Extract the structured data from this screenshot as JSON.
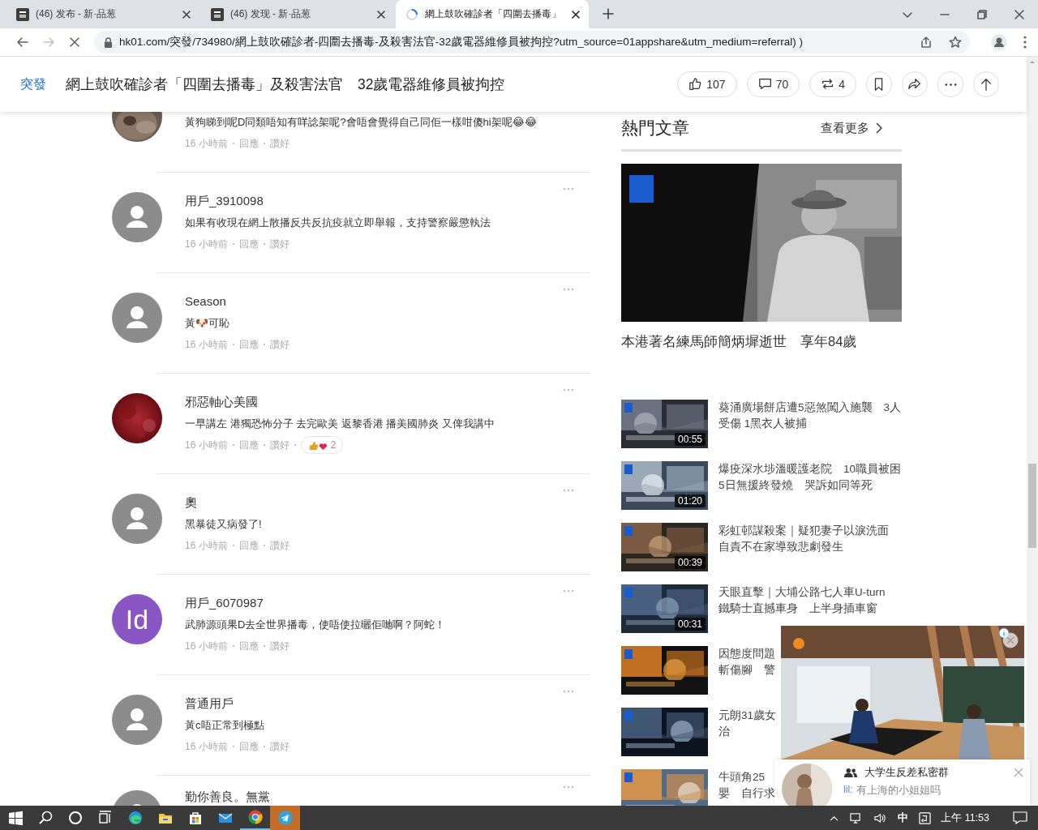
{
  "browser": {
    "tabs": [
      {
        "title": "(46) 发布 - 新·品葱",
        "selected": false,
        "loading": false
      },
      {
        "title": "(46) 发现 - 新·品葱",
        "selected": false,
        "loading": false
      },
      {
        "title": "網上鼓吹確診者「四圍去播毒」",
        "selected": true,
        "loading": true
      }
    ],
    "navigation": {
      "forward_disabled": true,
      "loading": true
    },
    "url": "hk01.com/突發/734980/網上鼓吹確診者-四圍去播毒-及殺害法官-32歲電器維修員被拘控?utm_source=01appshare&utm_medium=referral) )"
  },
  "header": {
    "category": "突發",
    "title": "網上鼓吹確診者「四圍去播毒」及殺害法官　32歲電器維修員被拘控",
    "actions": [
      {
        "kind": "like",
        "count": "107"
      },
      {
        "kind": "comment",
        "count": "70"
      },
      {
        "kind": "repost",
        "count": "4"
      },
      {
        "kind": "bookmark"
      },
      {
        "kind": "share"
      },
      {
        "kind": "more"
      },
      {
        "kind": "top"
      }
    ]
  },
  "comments": [
    {
      "text": "黃狗睇到呢D同類唔知有咩諗架呢?會唔會覺得自己同佢一樣咁傻hi架呢😂😂",
      "time": "16 小時前",
      "reply": "回應",
      "like": "讚好"
    },
    {
      "avatar": {
        "kind": "default"
      },
      "name": "用戶_3910098",
      "text": "如果有收現在網上散播反共反抗疫就立即舉報，支持警察嚴懲執法",
      "time": "16 小時前",
      "reply": "回應",
      "like": "讚好"
    },
    {
      "avatar": {
        "kind": "default"
      },
      "name": "Season",
      "text": "黃🐶可恥",
      "time": "16 小時前",
      "reply": "回應",
      "like": "讚好"
    },
    {
      "name": "邪惡軸心美國",
      "text": "一早講左 港獨恐怖分子 去完歐美 返黎香港 播美國肺炎 又俾我講中",
      "time": "16 小時前",
      "reply": "回應",
      "like": "讚好",
      "reactions": {
        "count": "2"
      }
    },
    {
      "avatar": {
        "kind": "default"
      },
      "name": "奧",
      "text": "黑暴徒又病發了!",
      "time": "16 小時前",
      "reply": "回應",
      "like": "讚好"
    },
    {
      "avatar": {
        "kind": "initials",
        "initials": "Id"
      },
      "name": "用戶_6070987",
      "text": "武肺源頭果D去全世界播毒，使唔使拉曬佢哋啊？阿蛇！",
      "time": "16 小時前",
      "reply": "回應",
      "like": "讚好"
    },
    {
      "avatar": {
        "kind": "default"
      },
      "name": "普通用戶",
      "text": "黃c唔正常到極點",
      "time": "16 小時前",
      "reply": "回應",
      "like": "讚好"
    },
    {
      "avatar": {
        "kind": "default"
      },
      "name": "勤你善良。無黨"
    }
  ],
  "sidebar": {
    "heading": "熱門文章",
    "more": "查看更多",
    "featured": {
      "caption": "本港著名練馬師簡炳墀逝世　享年84歲"
    },
    "articles": [
      {
        "duration": "00:55",
        "title_lines": [
          "葵涌廣場餅店遭5惡煞闖入施襲　3人",
          "受傷 1黑衣人被捕"
        ]
      },
      {
        "duration": "01:20",
        "title_lines": [
          "爆疫深水埗溫暖護老院　10職員被困",
          "5日無援終發燒　哭訴如同等死"
        ]
      },
      {
        "duration": "00:39",
        "title_lines": [
          "彩虹邨謀殺案｜疑犯妻子以淚洗面",
          "自責不在家導致悲劇發生"
        ]
      },
      {
        "duration": "00:31",
        "title_lines": [
          "天眼直擊｜大埔公路七人車U-turn",
          "鐵騎士直撼車身　上半身插車窗"
        ]
      },
      {
        "title_lines": [
          "因態度問題",
          "斬傷腳　警"
        ]
      },
      {
        "title_lines": [
          "元朗31歲女",
          "治"
        ]
      },
      {
        "title_lines": [
          "牛頭角25",
          "嬰　自行求"
        ]
      }
    ]
  },
  "chat": {
    "group": "大学生反差私密群",
    "sender": "lil:",
    "message": "有上海的小姐姐吗"
  },
  "taskbar": {
    "items": [
      {
        "kind": "start",
        "running": false,
        "highlighted": false
      },
      {
        "kind": "search",
        "running": false,
        "highlighted": false
      },
      {
        "kind": "cortana",
        "running": false,
        "highlighted": false
      },
      {
        "kind": "taskview",
        "running": false,
        "highlighted": false
      },
      {
        "kind": "edge",
        "running": false,
        "highlighted": false
      },
      {
        "kind": "explorer",
        "running": false,
        "highlighted": false
      },
      {
        "kind": "store",
        "running": false,
        "highlighted": false
      },
      {
        "kind": "mail",
        "running": false,
        "highlighted": false
      },
      {
        "kind": "chrome",
        "running": true,
        "highlighted": false
      },
      {
        "kind": "telegram",
        "running": false,
        "highlighted": true
      }
    ],
    "tray": {
      "ime": "中",
      "time": "上午 11:53"
    }
  }
}
